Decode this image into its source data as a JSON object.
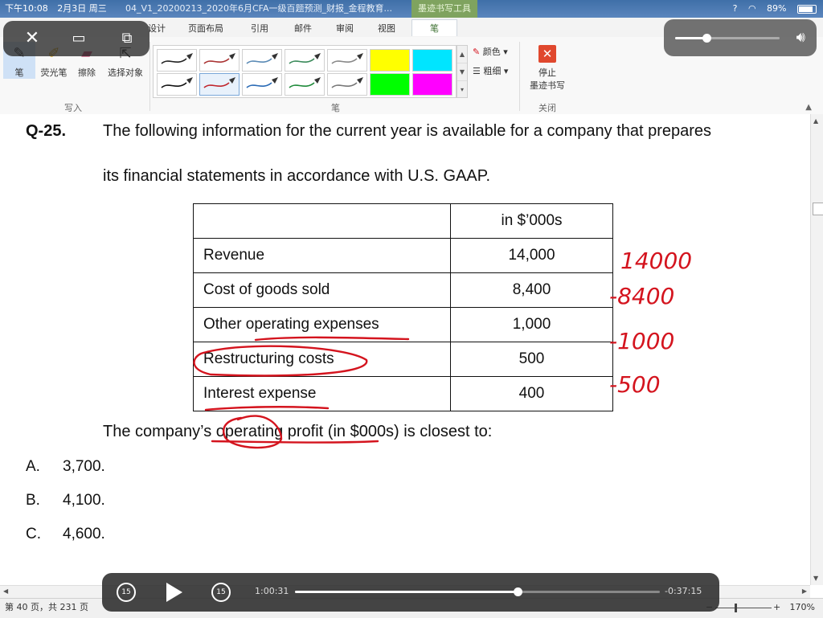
{
  "status_bar": {
    "time": "下午10:08",
    "date": "2月3日 周三",
    "doc_title": "04_V1_20200213_2020年6月CFA一级百题预测_财报_金程教育...",
    "tool_context": "墨迹书写工具",
    "help": "?",
    "battery": "89%"
  },
  "ribbon": {
    "tabs": [
      "设计",
      "页面布局",
      "引用",
      "邮件",
      "审阅",
      "视图"
    ],
    "active_tab": "笔",
    "tools": [
      {
        "label": "笔",
        "icon": "pen-icon"
      },
      {
        "label": "荧光笔",
        "icon": "highlighter-icon"
      },
      {
        "label": "擦除",
        "icon": "eraser-icon"
      },
      {
        "label": "选择对象",
        "icon": "select-objects-icon"
      }
    ],
    "group_write": "写入",
    "group_pen": "笔",
    "group_close": "关闭",
    "color_label": "颜色",
    "weight_label": "粗细",
    "stop_label_1": "停止",
    "stop_label_2": "墨迹书写",
    "pen_styles_top": [
      "#222222",
      "#a33",
      "#5a8ab5",
      "#3a8a5a",
      "#888888"
    ],
    "pen_styles_bottom": [
      "#111111",
      "#c0262d",
      "#2a6ab5",
      "#1f8a3a",
      "#777777"
    ],
    "highlighters": [
      "#ffff00",
      "#00e5ff",
      "#00ff00",
      "#ff00ff"
    ],
    "accent": "#2a6fb0"
  },
  "question": {
    "number": "Q-25.",
    "line1": "The following information for the current year is available for a company that prepares",
    "line2": "its financial statements in accordance with U.S. GAAP.",
    "table_header": [
      "",
      "in $’000s"
    ],
    "table_rows": [
      {
        "label": "Revenue",
        "value": "14,000"
      },
      {
        "label": "Cost of goods sold",
        "value": "8,400"
      },
      {
        "label": "Other operating expenses",
        "value": "1,000"
      },
      {
        "label": "Restructuring costs",
        "value": "500"
      },
      {
        "label": "Interest expense",
        "value": "400"
      }
    ],
    "prompt": "The company’s operating profit (in $000s) is closest to:",
    "answers": [
      {
        "key": "A.",
        "value": "3,700."
      },
      {
        "key": "B.",
        "value": "4,100."
      },
      {
        "key": "C.",
        "value": "4,600."
      }
    ]
  },
  "ink_annotations": {
    "notes": [
      "14000",
      "-8400",
      "-1000",
      "-500"
    ],
    "color": "#d4141e"
  },
  "statusline": {
    "pages": "第 40 页，共 231 页",
    "zoom": "170%"
  },
  "player": {
    "elapsed": "1:00:31",
    "remaining": "-0:37:15",
    "skip_back": "15",
    "skip_forward": "15",
    "progress": 0.61
  },
  "volume": {
    "level": 0.3
  }
}
